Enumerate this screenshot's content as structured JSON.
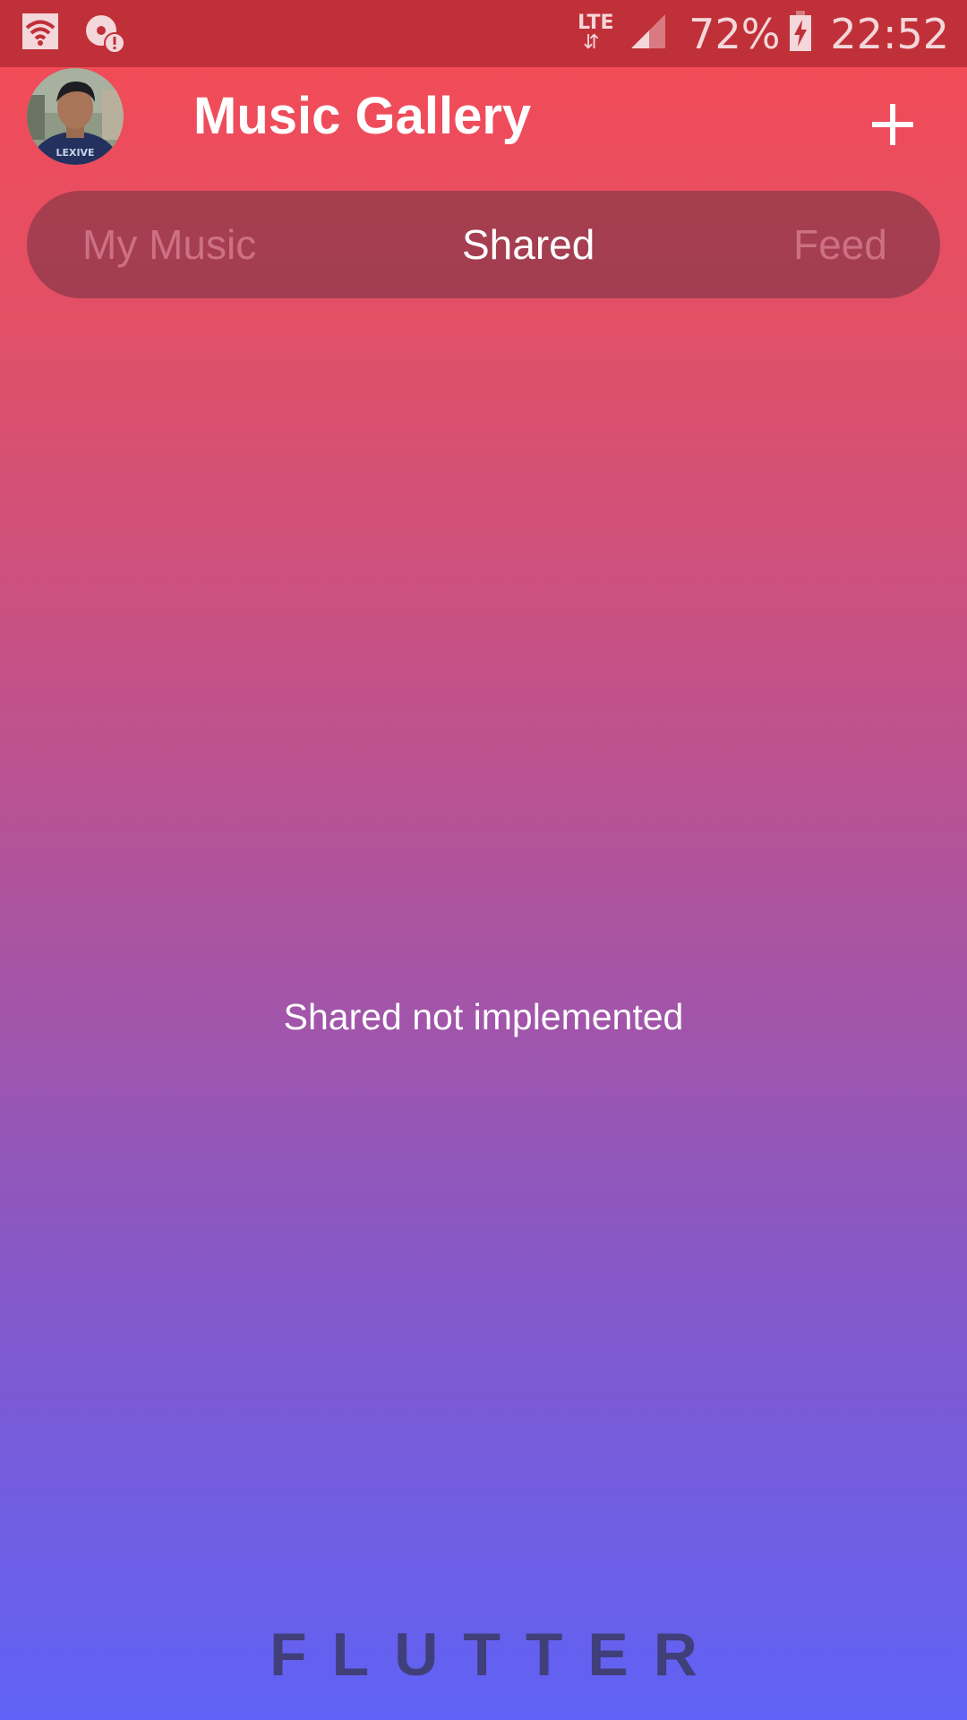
{
  "status_bar": {
    "network_type": "LTE",
    "data_arrows": "⇵",
    "battery_percent": "72%",
    "time": "22:52",
    "icons": [
      "wifi-icon",
      "data-saver-alert-icon",
      "signal-icon",
      "battery-charging-icon"
    ]
  },
  "app_bar": {
    "title": "Music Gallery",
    "avatar_icon": "user-avatar",
    "add_icon": "plus-icon"
  },
  "tabs": [
    {
      "label": "My Music",
      "active": false
    },
    {
      "label": "Shared",
      "active": true
    },
    {
      "label": "Feed",
      "active": false
    }
  ],
  "content": {
    "message": "Shared not implemented"
  },
  "footer": {
    "brand": "FLUTTER"
  },
  "colors": {
    "gradient_top": "#f64a54",
    "gradient_bottom": "#5f62f6",
    "status_bar": "#c03038",
    "brand_text": "#403f7a"
  }
}
